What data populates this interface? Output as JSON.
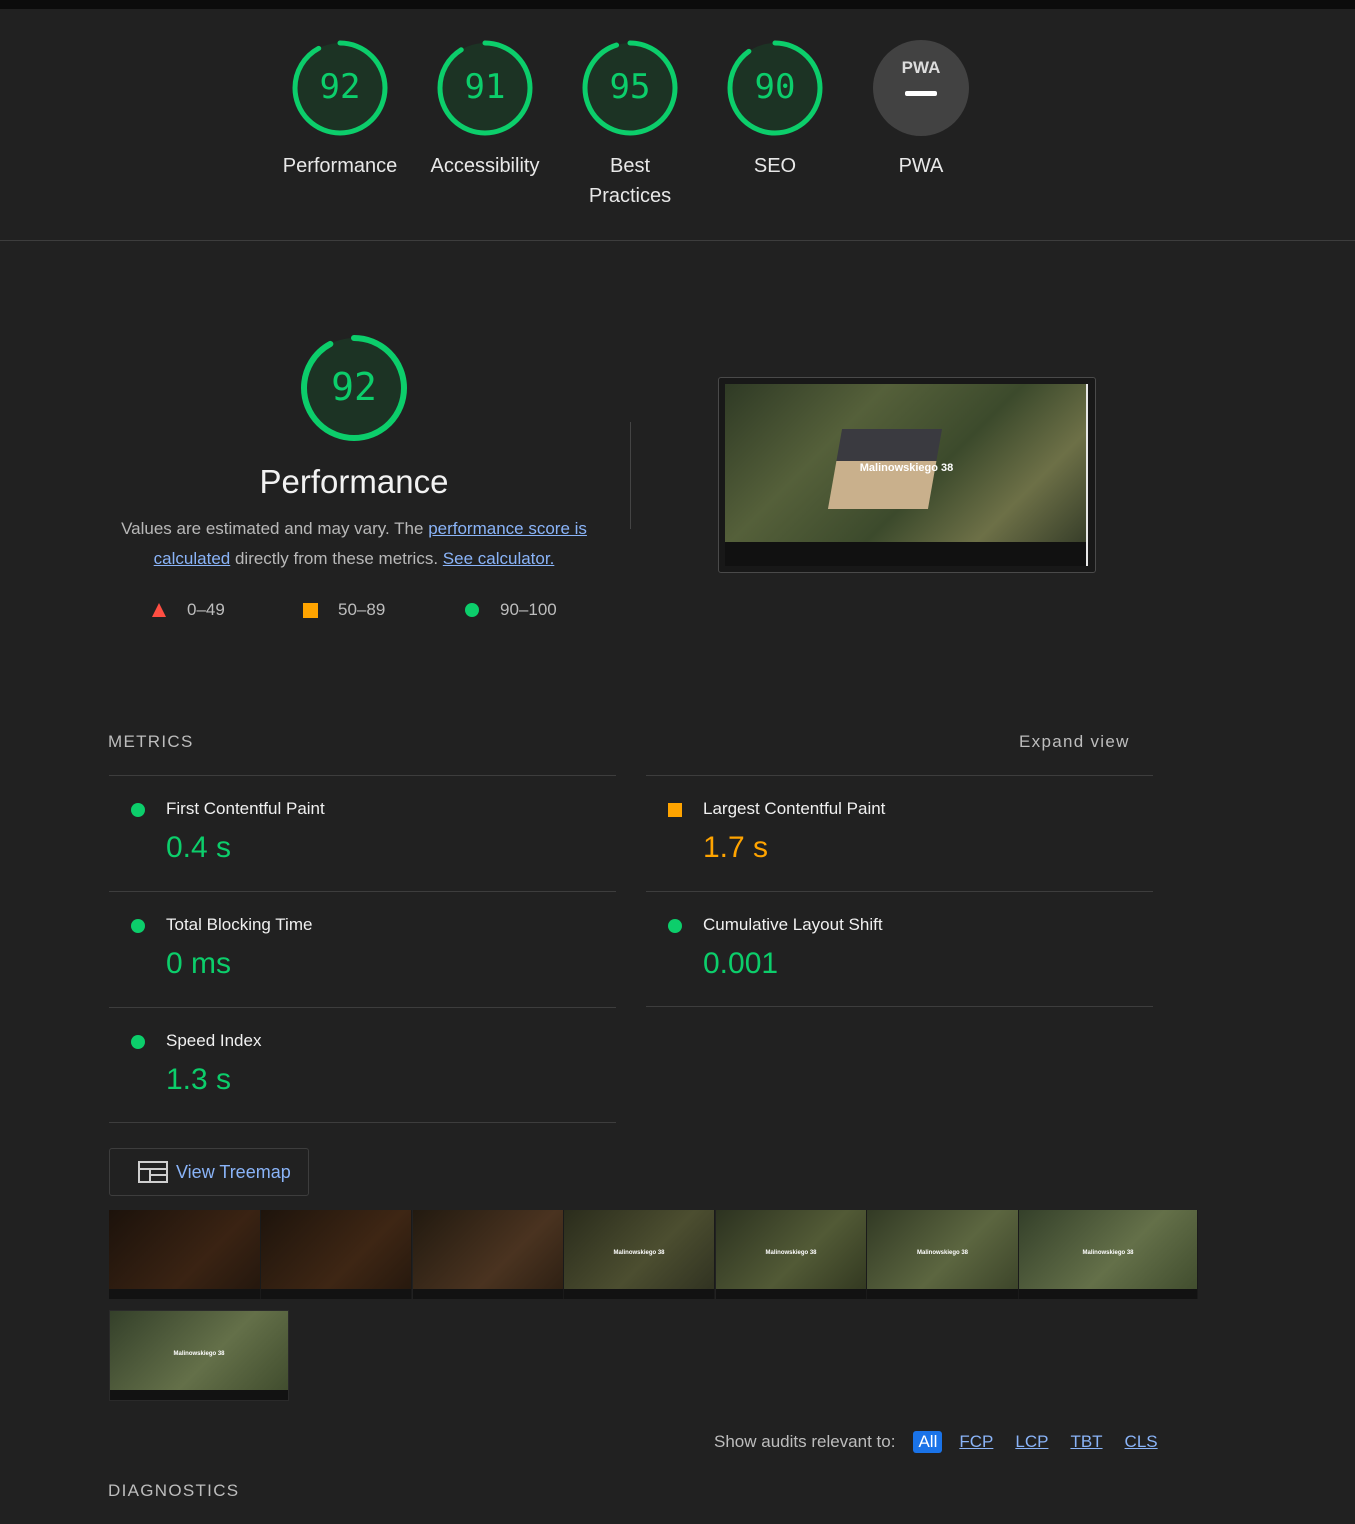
{
  "categories": [
    {
      "label": "Performance",
      "score": "92",
      "fraction": 0.92
    },
    {
      "label": "Accessibility",
      "score": "91",
      "fraction": 0.91
    },
    {
      "label": "Best Practices",
      "score": "95",
      "fraction": 0.95
    },
    {
      "label": "SEO",
      "score": "90",
      "fraction": 0.9
    },
    {
      "label": "PWA",
      "badge": "PWA"
    }
  ],
  "performance": {
    "score": "92",
    "fraction": 0.92,
    "title": "Performance",
    "desc_prefix": "Values are estimated and may vary. The ",
    "desc_link1": "performance score is calculated",
    "desc_middle": " directly from these metrics. ",
    "desc_link2": "See calculator."
  },
  "legend": {
    "fail": "0–49",
    "average": "50–89",
    "pass": "90–100"
  },
  "screenshot": {
    "site_title": "Malinowskiego 38"
  },
  "metrics": {
    "heading": "METRICS",
    "expand": "Expand view",
    "fcp": {
      "label": "First Contentful Paint",
      "value": "0.4 s"
    },
    "lcp": {
      "label": "Largest Contentful Paint",
      "value": "1.7 s"
    },
    "tbt": {
      "label": "Total Blocking Time",
      "value": "0 ms"
    },
    "cls": {
      "label": "Cumulative Layout Shift",
      "value": "0.001"
    },
    "si": {
      "label": "Speed Index",
      "value": "1.3 s"
    }
  },
  "treemap_label": "View Treemap",
  "filmstrip_title": "Malinowskiego 38",
  "audit_filter": {
    "label": "Show audits relevant to:",
    "all": "All",
    "fcp": "FCP",
    "lcp": "LCP",
    "tbt": "TBT",
    "cls": "CLS"
  },
  "diagnostics_heading": "DIAGNOSTICS",
  "colors": {
    "pass": "#0cce6b",
    "average": "#ffa400",
    "fail": "#ff4e42",
    "link": "#8ab4f8"
  }
}
